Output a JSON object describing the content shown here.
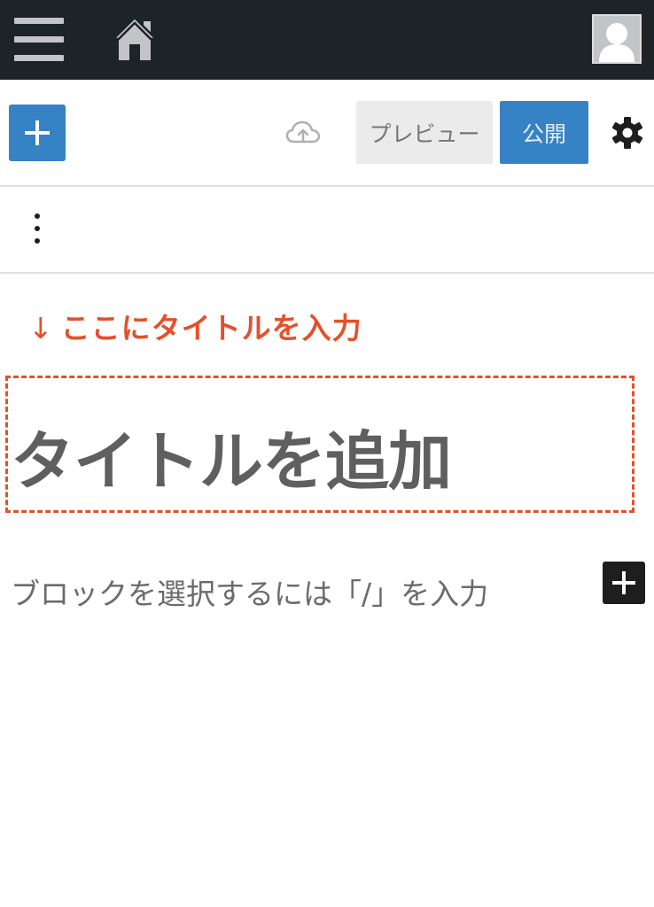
{
  "admin_bar": {
    "menu_icon": "hamburger-menu-icon",
    "home_icon": "home-icon",
    "avatar_icon": "user-avatar-icon",
    "colors": {
      "background": "#1d2327",
      "icon": "#c3c4c7"
    }
  },
  "toolbar": {
    "inserter_icon": "plus-icon",
    "save_icon": "cloud-upload-icon",
    "preview_label": "プレビュー",
    "publish_label": "公開",
    "settings_icon": "gear-icon",
    "colors": {
      "accent": "#3582c4",
      "preview_bg": "#ebebeb"
    }
  },
  "options_bar": {
    "more_icon": "vertical-ellipsis-icon"
  },
  "annotation": {
    "arrow": "↓",
    "text": "ここにタイトルを入力",
    "color": "#e4502a"
  },
  "editor": {
    "title_placeholder": "タイトルを追加",
    "block_placeholder": "ブロックを選択するには「/」を入力",
    "block_inserter_icon": "plus-icon"
  }
}
